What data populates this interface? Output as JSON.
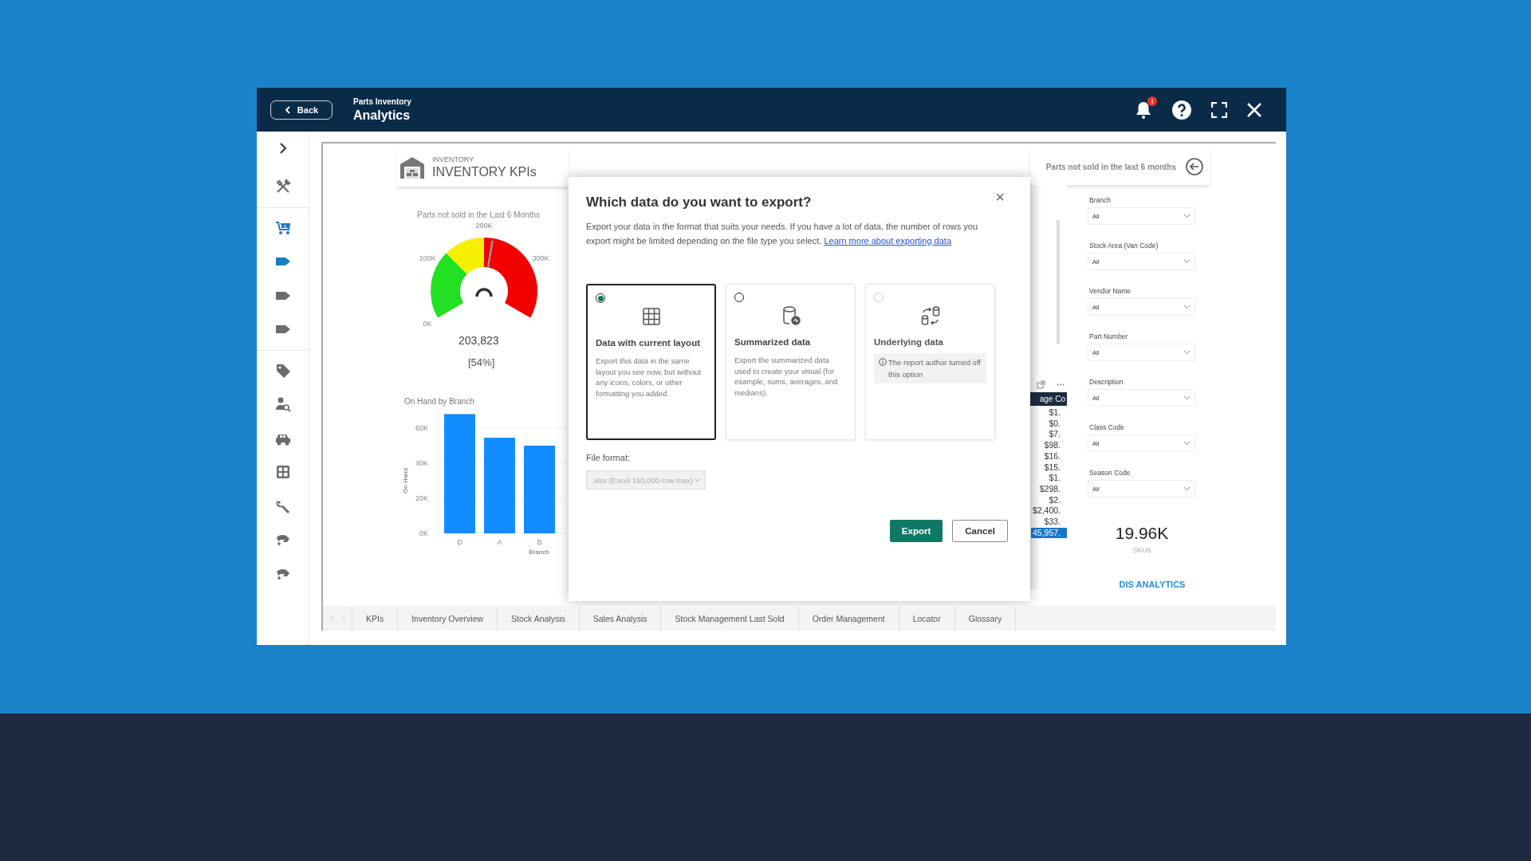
{
  "header": {
    "back": "Back",
    "subtitle": "Parts Inventory",
    "title": "Analytics",
    "notification_badge": "!"
  },
  "sidebar": {
    "sections": [
      {
        "items": [
          {
            "kind": "tools",
            "selected": false
          }
        ]
      },
      {
        "items": [
          {
            "kind": "cart",
            "selected": true
          },
          {
            "kind": "label",
            "selected": true
          },
          {
            "kind": "label",
            "selected": false
          },
          {
            "kind": "label",
            "selected": false
          }
        ]
      },
      {
        "items": [
          {
            "kind": "tag",
            "selected": false
          },
          {
            "kind": "user-search",
            "selected": false
          },
          {
            "kind": "car",
            "selected": false
          },
          {
            "kind": "grid",
            "selected": false
          },
          {
            "kind": "wrench",
            "selected": false
          },
          {
            "kind": "hand",
            "selected": false
          },
          {
            "kind": "hand",
            "selected": false
          }
        ]
      }
    ]
  },
  "report": {
    "kpi_header": {
      "overline": "INVENTORY",
      "title": "INVENTORY KPIs"
    },
    "gauge": {
      "title": "Parts not sold in the Last 6 Months",
      "ticks": [
        "0K",
        "100K",
        "200K",
        "300K"
      ],
      "level": 0.54,
      "value": "203,823",
      "percent": "[54%]"
    },
    "bar_chart": {
      "chart_data": {
        "type": "bar",
        "title": "On Hand by Branch",
        "xlabel": "Branch",
        "ylabel": "On Hand",
        "categories": [
          "D",
          "A",
          "B"
        ],
        "values": [
          68000,
          54500,
          50000
        ],
        "grid": true,
        "ylim": [
          0,
          70000
        ],
        "yticks": [
          {
            "value": 0,
            "label": "0K"
          },
          {
            "value": 20000,
            "label": "20K"
          },
          {
            "value": 40000,
            "label": "40K"
          },
          {
            "value": 60000,
            "label": "60K"
          }
        ]
      }
    },
    "side_header": {
      "title": "Parts not sold in the last 6 months"
    },
    "table": {
      "column_1": "age Co",
      "rows": [
        "$1.",
        "$0.",
        "$7.",
        "$98.",
        "$16.",
        "$15.",
        "$1.",
        "$298.",
        "$2.",
        "$2,400.",
        "$33."
      ],
      "total": "45,957."
    },
    "filters": [
      {
        "label": "Branch",
        "value": "All"
      },
      {
        "label": "Stock Area (Van Code)",
        "value": "All"
      },
      {
        "label": "Vendor Name",
        "value": "All"
      },
      {
        "label": "Part Number",
        "value": "All"
      },
      {
        "label": "Description",
        "value": "All"
      },
      {
        "label": "Class Code",
        "value": "All"
      },
      {
        "label": "Season Code",
        "value": "All"
      }
    ],
    "kpi_card": {
      "value": "19.96K",
      "label": "SKUs"
    },
    "brand": "DIS ANALYTICS",
    "tabs": [
      {
        "label": "KPIs"
      },
      {
        "label": "Inventory Overview"
      },
      {
        "label": "Stock Analysis"
      },
      {
        "label": "Sales Analysis"
      },
      {
        "label": "Stock Management Last Sold"
      },
      {
        "label": "Order Management"
      },
      {
        "label": "Locator"
      },
      {
        "label": "Glossary"
      }
    ]
  },
  "dialog": {
    "title": "Which data do you want to export?",
    "close": "×",
    "description": "Export your data in the format that suits your needs. If you have a lot of data, the number of rows you export might be limited depending on the file type you select.",
    "link": "Learn more about exporting data",
    "options": [
      {
        "kind": "table",
        "title": "Data with current layout",
        "description": "Export this data in the same layout you see now, but without any icons, colors, or other formatting you added.",
        "selected": true,
        "disabled": false
      },
      {
        "kind": "summary",
        "title": "Summarized data",
        "description": "Export the summarized data used to create your visual (for example, sums, averages, and medians).",
        "selected": false,
        "disabled": false
      },
      {
        "kind": "underlying",
        "title": "Underlying data",
        "note": "The report author turned off this option",
        "selected": false,
        "disabled": true
      }
    ],
    "file_format": {
      "label": "File format:",
      "value": ".xlsx (Excel 150,000-row max)",
      "disabled": true
    },
    "buttons": [
      {
        "kind": "primary",
        "label": "Export"
      },
      {
        "kind": "secondary",
        "label": "Cancel"
      }
    ]
  }
}
